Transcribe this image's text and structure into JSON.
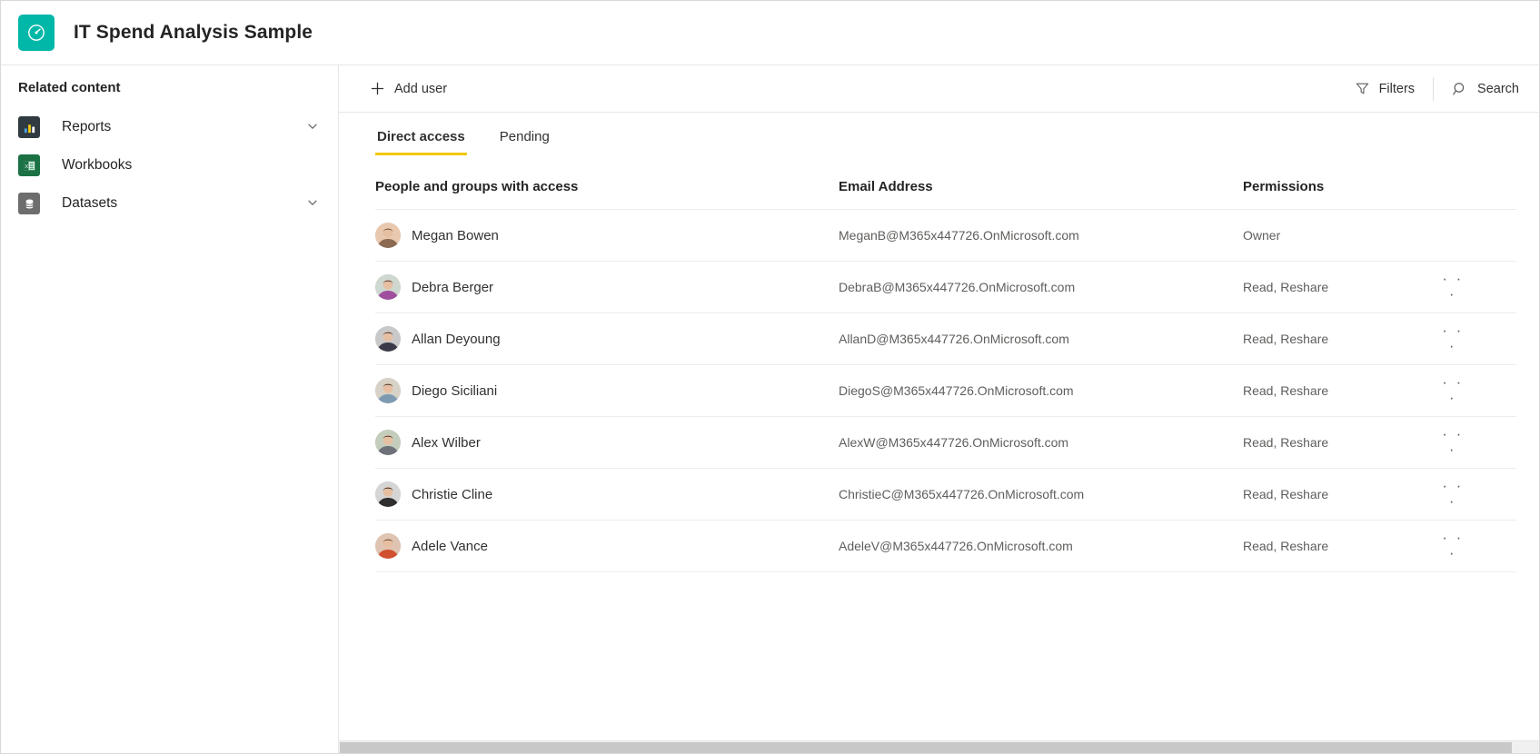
{
  "header": {
    "app_icon": "gauge-icon",
    "title": "IT Spend Analysis Sample",
    "accent_color": "#00b7a8"
  },
  "sidebar": {
    "title": "Related content",
    "items": [
      {
        "label": "Reports",
        "icon": "bar-chart-icon",
        "icon_color": "#2f3b41",
        "expandable": true
      },
      {
        "label": "Workbooks",
        "icon": "excel-icon",
        "icon_color": "#1b7144",
        "expandable": false
      },
      {
        "label": "Datasets",
        "icon": "database-icon",
        "icon_color": "#6d6d6d",
        "expandable": true
      }
    ]
  },
  "toolbar": {
    "add_user_label": "Add user",
    "add_user_icon": "plus-icon",
    "filters_label": "Filters",
    "filters_icon": "funnel-icon",
    "search_label": "Search",
    "search_icon": "search-icon"
  },
  "tabs": [
    {
      "label": "Direct access",
      "active": true
    },
    {
      "label": "Pending",
      "active": false
    }
  ],
  "tab_accent_color": "#f2c811",
  "table": {
    "columns": [
      "People and groups with access",
      "Email Address",
      "Permissions",
      ""
    ],
    "menu_glyph": "· · ·",
    "rows": [
      {
        "name": "Megan Bowen",
        "email": "MeganB@M365x447726.OnMicrosoft.com",
        "permission": "Owner",
        "has_menu": false
      },
      {
        "name": "Debra Berger",
        "email": "DebraB@M365x447726.OnMicrosoft.com",
        "permission": "Read, Reshare",
        "has_menu": true
      },
      {
        "name": "Allan Deyoung",
        "email": "AllanD@M365x447726.OnMicrosoft.com",
        "permission": "Read, Reshare",
        "has_menu": true
      },
      {
        "name": "Diego Siciliani",
        "email": "DiegoS@M365x447726.OnMicrosoft.com",
        "permission": "Read, Reshare",
        "has_menu": true
      },
      {
        "name": "Alex Wilber",
        "email": "AlexW@M365x447726.OnMicrosoft.com",
        "permission": "Read, Reshare",
        "has_menu": true
      },
      {
        "name": "Christie Cline",
        "email": "ChristieC@M365x447726.OnMicrosoft.com",
        "permission": "Read, Reshare",
        "has_menu": true
      },
      {
        "name": "Adele Vance",
        "email": "AdeleV@M365x447726.OnMicrosoft.com",
        "permission": "Read, Reshare",
        "has_menu": true
      }
    ]
  }
}
